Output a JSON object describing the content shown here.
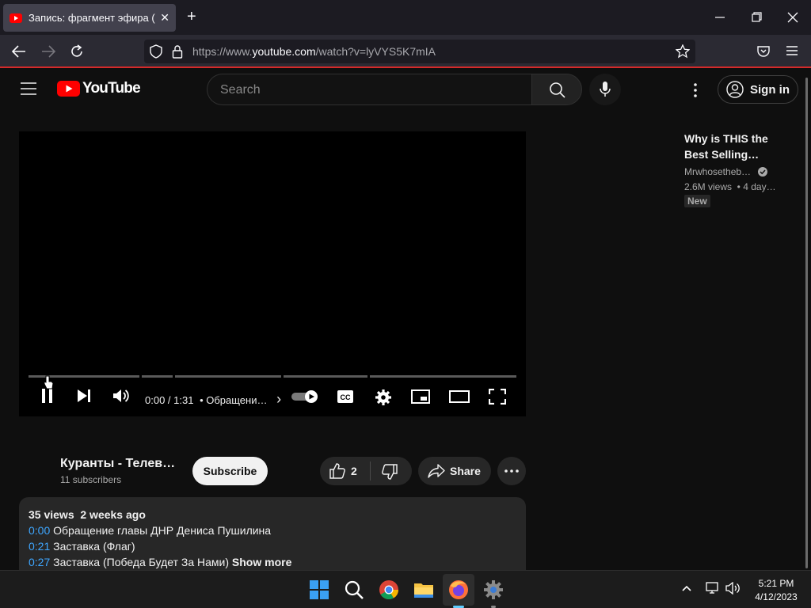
{
  "browser": {
    "tab_title": "Запись: фрагмент эфира (Онлайн)",
    "tab_close": "✕",
    "new_tab": "+",
    "url_prefix": "https://www.",
    "url_domain": "youtube.com",
    "url_path": "/watch?v=lyVYS5K7mIA"
  },
  "youtube": {
    "logo_text": "YouTube",
    "search_placeholder": "Search",
    "signin_label": "Sign in"
  },
  "player": {
    "time": "0:00 / 1:31",
    "chapter": "• Обращени…",
    "chapter_arrow": "›"
  },
  "video": {
    "channel_name": "Куранты - Телев…",
    "subscribers": "11 subscribers",
    "subscribe_label": "Subscribe",
    "like_count": "2",
    "share_label": "Share"
  },
  "description": {
    "stats": "35 views  2 weeks ago",
    "chapters": [
      {
        "time": "0:00",
        "text": " Обращение главы ДНР Дениса Пушилина"
      },
      {
        "time": "0:21",
        "text": " Заставка (Флаг)"
      },
      {
        "time": "0:27",
        "text": " Заставка (Победа Будет За Нами)"
      }
    ],
    "show_more": "Show more"
  },
  "recommended": {
    "title": "Why is THIS the Best Selling…",
    "channel": "Mrwhosetheb…",
    "meta": "2.6M views  • 4 day…",
    "badge": "New"
  },
  "taskbar": {
    "time": "5:21 PM",
    "date": "4/12/2023"
  },
  "colors": {
    "accent_red": "#ff0000",
    "link_blue": "#3ea6ff",
    "bg": "#0f0f0f"
  }
}
